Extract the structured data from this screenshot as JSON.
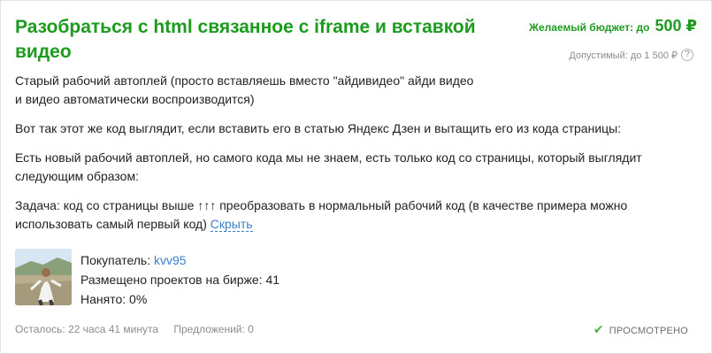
{
  "project": {
    "title": "Разобраться с html связанное с iframe и вставкой видео",
    "budget": {
      "label": "Желаемый бюджет: до",
      "amount": "500 ₽",
      "allowed": "Допустимый: до 1 500 ₽",
      "help": "?"
    },
    "description": [
      "Старый рабочий автоплей (просто вставляешь вместо \"айдивидео\" айди видео и видео автоматически воспроизводится)",
      "Вот так этот же код выглядит, если вставить его в статью Яндекс Дзен и вытащить его из кода страницы:",
      "Есть новый рабочий автоплей, но самого кода мы не знаем, есть только код со страницы, который выглядит следующим образом:",
      "Задача: код со страницы выше ↑↑↑ преобразовать в нормальный рабочий код (в качестве примера можно использовать самый первый код)"
    ],
    "hide_link": "Скрыть"
  },
  "buyer": {
    "label": "Покупатель:",
    "name": "kvv95",
    "projects_label": "Размещено проектов на бирже: 41",
    "hired_label": "Нанято: 0%"
  },
  "footer": {
    "time_left": "Осталось: 22 часа 41 минута",
    "offers": "Предложений: 0",
    "viewed": "ПРОСМОТРЕНО",
    "viewed_icon": "checkmark-icon"
  },
  "colors": {
    "title_green": "#1c9b1f",
    "link_blue": "#3a7fc8",
    "muted_gray": "#8c8c8c",
    "viewed_check": "#4caf50"
  }
}
